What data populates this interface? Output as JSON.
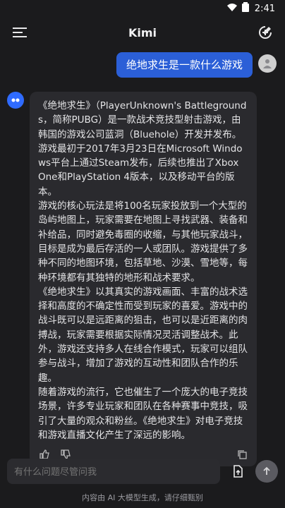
{
  "status": {
    "time": "2:41"
  },
  "header": {
    "title": "Kimi"
  },
  "user": {
    "message": "绝地求生是一款什么游戏"
  },
  "assistant": {
    "message": "《绝地求生》（PlayerUnknown's Battlegrounds，简称PUBG）是一款战术竞技型射击游戏，由韩国的游戏公司蓝洞（Bluehole）开发并发布。游戏最初于2017年3月23日在Microsoft Windows平台上通过Steam发布，后续也推出了Xbox One和PlayStation 4版本，以及移动平台的版本。\n游戏的核心玩法是将100名玩家投放到一个大型的岛屿地图上，玩家需要在地图上寻找武器、装备和补给品，同时避免毒圈的收缩，与其他玩家战斗，目标是成为最后存活的一人或团队。游戏提供了多种不同的地图环境，包括草地、沙漠、雪地等，每种环境都有其独特的地形和战术要求。\n《绝地求生》以其真实的游戏画面、丰富的战术选择和高度的不确定性而受到玩家的喜爱。游戏中的战斗既可以是远距离的狙击，也可以是近距离的肉搏战，玩家需要根据实际情况灵活调整战术。此外，游戏还支持多人在线合作模式，玩家可以组队参与战斗，增加了游戏的互动性和团队合作的乐趣。\n随着游戏的流行，它也催生了一个庞大的电子竞技场景，许多专业玩家和团队在各种赛事中竞技，吸引了大量的观众和粉丝。《绝地求生》对电子竞技和游戏直播文化产生了深远的影响。"
  },
  "composer": {
    "placeholder": "有什么问题尽管问我"
  },
  "footer": {
    "text": "内容由 AI 大模型生成，请仔细甄别"
  },
  "colors": {
    "accent": "#2b5fd7",
    "bubble": "#2a2a2e",
    "background": "#1b1b1d"
  },
  "icons": [
    "wifi-icon",
    "battery-icon",
    "menu-icon",
    "new-chat-icon",
    "user-avatar-icon",
    "bot-avatar-icon",
    "thumb-up-icon",
    "thumb-down-icon",
    "copy-icon",
    "upload-file-icon",
    "send-arrow-icon"
  ]
}
